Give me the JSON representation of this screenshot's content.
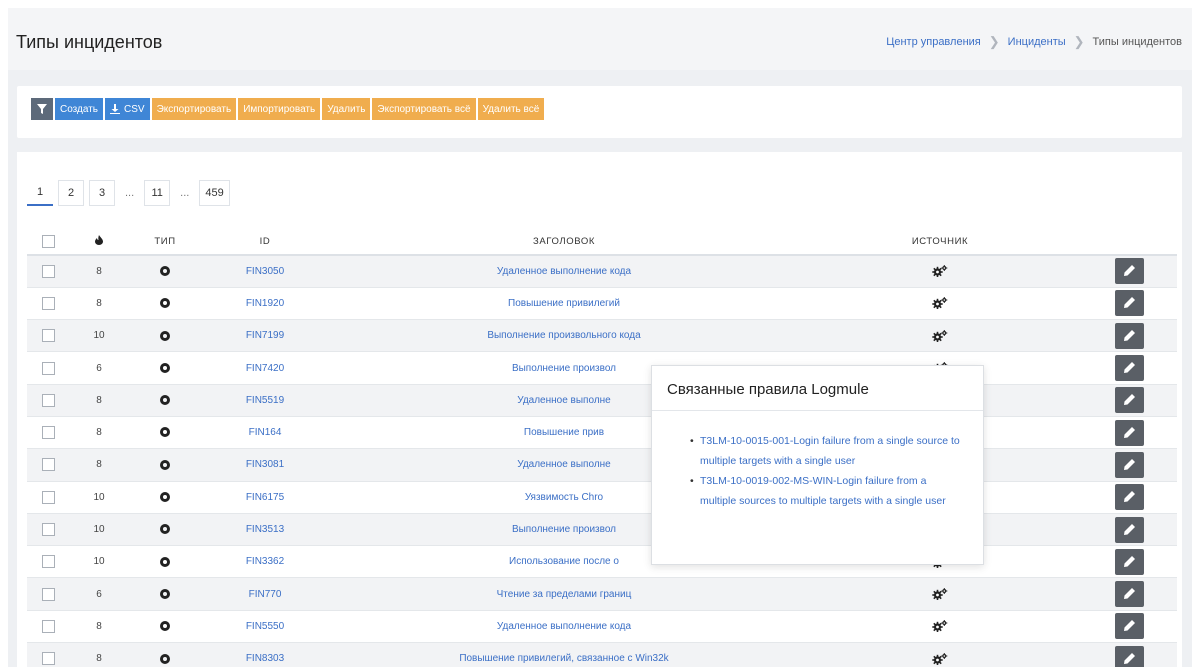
{
  "header": {
    "title": "Типы инцидентов",
    "breadcrumb": [
      "Центр управления",
      "Инциденты",
      "Типы инцидентов"
    ]
  },
  "toolbar": {
    "create_label": "Создать",
    "csv_label": "CSV",
    "export_label": "Экспортировать",
    "import_label": "Импортировать",
    "delete_label": "Удалить",
    "export_all_label": "Экспортировать всё",
    "delete_all_label": "Удалить всё"
  },
  "pagination": {
    "pages": [
      "1",
      "2",
      "3",
      "...",
      "11",
      "...",
      "459"
    ],
    "current": "1"
  },
  "table": {
    "columns": [
      "",
      "",
      "ТИП",
      "ID",
      "ЗАГОЛОВОК",
      "ИСТОЧНИК",
      ""
    ],
    "rows": [
      {
        "severity": "8",
        "id": "FIN3050",
        "title": "Удаленное выполнение кода"
      },
      {
        "severity": "8",
        "id": "FIN1920",
        "title": "Повышение привилегий"
      },
      {
        "severity": "10",
        "id": "FIN7199",
        "title": "Выполнение произвольного кода"
      },
      {
        "severity": "6",
        "id": "FIN7420",
        "title": "Выполнение произвол"
      },
      {
        "severity": "8",
        "id": "FIN5519",
        "title": "Удаленное выполне"
      },
      {
        "severity": "8",
        "id": "FIN164",
        "title": "Повышение прив"
      },
      {
        "severity": "8",
        "id": "FIN3081",
        "title": "Удаленное выполне"
      },
      {
        "severity": "10",
        "id": "FIN6175",
        "title": "Уязвимость Chro"
      },
      {
        "severity": "10",
        "id": "FIN3513",
        "title": "Выполнение произвол"
      },
      {
        "severity": "10",
        "id": "FIN3362",
        "title": "Использование после о"
      },
      {
        "severity": "6",
        "id": "FIN770",
        "title": "Чтение за пределами границ"
      },
      {
        "severity": "8",
        "id": "FIN5550",
        "title": "Удаленное выполнение кода"
      },
      {
        "severity": "8",
        "id": "FIN8303",
        "title": "Повышение привилегий, связанное с Win32k"
      }
    ]
  },
  "popover": {
    "title": "Связанные правила Logmule",
    "items": [
      "T3LM-10-0015-001-Login failure from a single source to multiple targets with a single user",
      "T3LM-10-0019-002-MS-WIN-Login failure from a multiple sources to multiple targets with a single user"
    ]
  },
  "icons": {
    "filter": "filter-icon",
    "download": "download-icon",
    "severity": "fire-icon",
    "type": "circle-icon",
    "source": "gears-icon",
    "edit": "pencil-icon"
  },
  "colors": {
    "link": "#3b6fc6",
    "primary": "#3f86d6",
    "warning": "#f0ad4e",
    "dark": "#5d6a7a"
  }
}
